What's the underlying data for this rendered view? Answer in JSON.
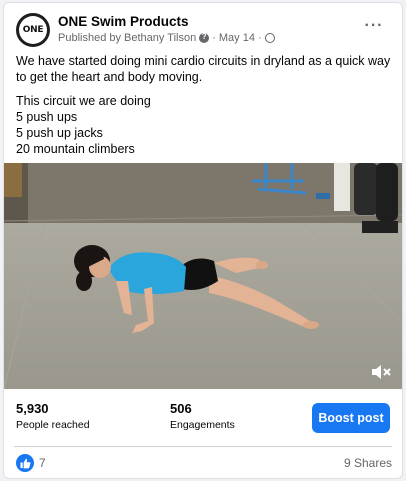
{
  "post": {
    "page_name": "ONE Swim Products",
    "avatar_text": "ONE",
    "published_by": "Published by Bethany Tilson",
    "date": "May 14",
    "separator": "·",
    "more_label": "···",
    "text": {
      "line1": "We have started doing mini cardio circuits in dryland as a quick way to get the heart and body moving.",
      "line2": "This circuit we are doing",
      "line3": "5 push ups",
      "line4": "5 push up jacks",
      "line5": "20 mountain climbers"
    }
  },
  "video": {
    "muted": true
  },
  "stats": {
    "reached_value": "5,930",
    "reached_label": "People reached",
    "engagements_value": "506",
    "engagements_label": "Engagements",
    "boost_label": "Boost post"
  },
  "footer": {
    "like_count": "7",
    "shares": "9 Shares"
  },
  "colors": {
    "accent": "#1877f2",
    "secondary_text": "#65676b"
  },
  "icons": [
    "info-icon",
    "globe-icon",
    "more-icon",
    "mute-icon",
    "like-icon"
  ]
}
